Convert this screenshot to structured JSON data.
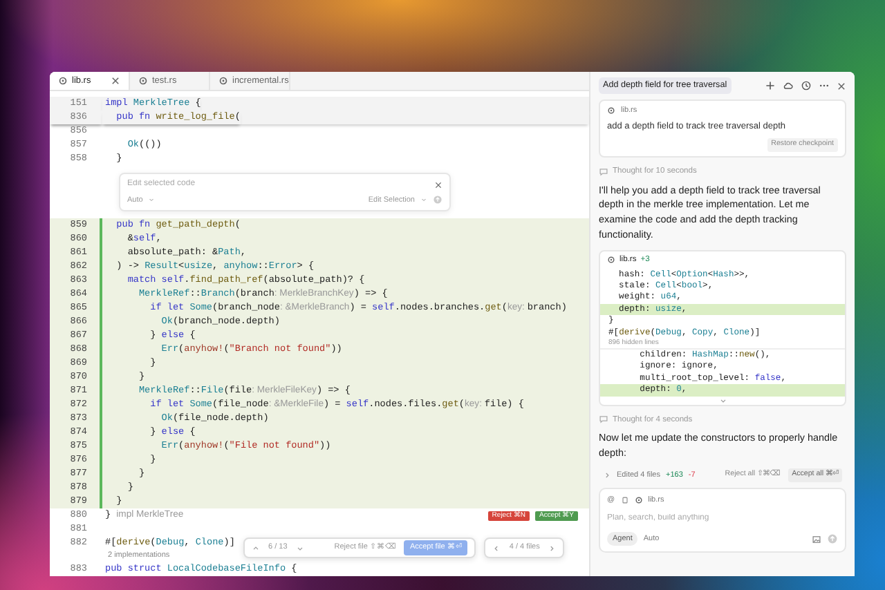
{
  "tabs": [
    {
      "label": "lib.rs",
      "selected": true
    },
    {
      "label": "test.rs",
      "selected": false
    },
    {
      "label": "incremental.rs",
      "selected": false
    }
  ],
  "editor": {
    "lines": [
      {
        "kind": "code",
        "number": "151",
        "sticky": true,
        "added": false,
        "tokens": [
          {
            "kind": "kw",
            "text": "impl "
          },
          {
            "kind": "type",
            "text": "MerkleTree"
          },
          {
            "kind": "plain",
            "text": " {"
          }
        ]
      },
      {
        "kind": "code",
        "number": "836",
        "sticky": true,
        "added": false,
        "tokens": [
          {
            "kind": "kw",
            "text": "  pub fn "
          },
          {
            "kind": "fn",
            "text": "write_log_file"
          },
          {
            "kind": "plain",
            "text": "("
          }
        ]
      },
      {
        "kind": "code",
        "number": "856",
        "sticky": false,
        "added": false
      },
      {
        "kind": "code",
        "number": "857",
        "sticky": false,
        "added": false,
        "tokens": [
          {
            "kind": "type",
            "text": "    Ok"
          },
          {
            "kind": "plain",
            "text": "(())"
          }
        ]
      },
      {
        "kind": "code",
        "number": "858",
        "sticky": false,
        "added": false,
        "tokens": [
          {
            "kind": "plain",
            "text": "  }"
          }
        ]
      },
      {
        "kind": "inline_edit",
        "placeholder": "Edit selected code",
        "model": "Auto",
        "action": "Edit Selection"
      },
      {
        "kind": "code",
        "number": "859",
        "sticky": false,
        "added": true,
        "tokens": [
          {
            "kind": "kw",
            "text": "  pub fn "
          },
          {
            "kind": "fn",
            "text": "get_path_depth"
          },
          {
            "kind": "plain",
            "text": "("
          }
        ]
      },
      {
        "kind": "code",
        "number": "860",
        "sticky": false,
        "added": true,
        "tokens": [
          {
            "kind": "plain",
            "text": "    &"
          },
          {
            "kind": "kw",
            "text": "self"
          },
          {
            "kind": "plain",
            "text": ","
          }
        ]
      },
      {
        "kind": "code",
        "number": "861",
        "sticky": false,
        "added": true,
        "tokens": [
          {
            "kind": "plain",
            "text": "    absolute_path: &"
          },
          {
            "kind": "type",
            "text": "Path"
          },
          {
            "kind": "plain",
            "text": ","
          }
        ]
      },
      {
        "kind": "code",
        "number": "862",
        "sticky": false,
        "added": true,
        "tokens": [
          {
            "kind": "plain",
            "text": "  ) -> "
          },
          {
            "kind": "type",
            "text": "Result"
          },
          {
            "kind": "plain",
            "text": "<"
          },
          {
            "kind": "type",
            "text": "usize"
          },
          {
            "kind": "plain",
            "text": ", "
          },
          {
            "kind": "type",
            "text": "anyhow"
          },
          {
            "kind": "plain",
            "text": "::"
          },
          {
            "kind": "type",
            "text": "Error"
          },
          {
            "kind": "plain",
            "text": "> {"
          }
        ]
      },
      {
        "kind": "code",
        "number": "863",
        "sticky": false,
        "added": true,
        "tokens": [
          {
            "kind": "kw",
            "text": "    match self"
          },
          {
            "kind": "plain",
            "text": "."
          },
          {
            "kind": "fn",
            "text": "find_path_ref"
          },
          {
            "kind": "plain",
            "text": "(absolute_path)? {"
          }
        ]
      },
      {
        "kind": "code",
        "number": "864",
        "sticky": false,
        "added": true,
        "tokens": [
          {
            "kind": "type",
            "text": "      MerkleRef"
          },
          {
            "kind": "plain",
            "text": "::"
          },
          {
            "kind": "type",
            "text": "Branch"
          },
          {
            "kind": "plain",
            "text": "(branch"
          },
          {
            "kind": "hint",
            "text": ": MerkleBranchKey"
          },
          {
            "kind": "plain",
            "text": ") => {"
          }
        ]
      },
      {
        "kind": "code",
        "number": "865",
        "sticky": false,
        "added": true,
        "tokens": [
          {
            "kind": "kw",
            "text": "        if let "
          },
          {
            "kind": "type",
            "text": "Some"
          },
          {
            "kind": "plain",
            "text": "(branch_node"
          },
          {
            "kind": "hint",
            "text": ": &MerkleBranch"
          },
          {
            "kind": "plain",
            "text": ") = "
          },
          {
            "kind": "kw",
            "text": "self"
          },
          {
            "kind": "plain",
            "text": ".nodes.branches."
          },
          {
            "kind": "fn",
            "text": "get"
          },
          {
            "kind": "plain",
            "text": "("
          },
          {
            "kind": "hint",
            "text": "key: "
          },
          {
            "kind": "plain",
            "text": "branch)"
          }
        ]
      },
      {
        "kind": "code",
        "number": "866",
        "sticky": false,
        "added": true,
        "tokens": [
          {
            "kind": "type",
            "text": "          Ok"
          },
          {
            "kind": "plain",
            "text": "(branch_node.depth)"
          }
        ]
      },
      {
        "kind": "code",
        "number": "867",
        "sticky": false,
        "added": true,
        "tokens": [
          {
            "kind": "plain",
            "text": "        } "
          },
          {
            "kind": "kw",
            "text": "else"
          },
          {
            "kind": "plain",
            "text": " {"
          }
        ]
      },
      {
        "kind": "code",
        "number": "868",
        "sticky": false,
        "added": true,
        "tokens": [
          {
            "kind": "type",
            "text": "          Err"
          },
          {
            "kind": "plain",
            "text": "("
          },
          {
            "kind": "macro",
            "text": "anyhow!"
          },
          {
            "kind": "plain",
            "text": "("
          },
          {
            "kind": "str",
            "text": "\"Branch not found\""
          },
          {
            "kind": "plain",
            "text": "))"
          }
        ]
      },
      {
        "kind": "code",
        "number": "869",
        "sticky": false,
        "added": true,
        "tokens": [
          {
            "kind": "plain",
            "text": "        }"
          }
        ]
      },
      {
        "kind": "code",
        "number": "870",
        "sticky": false,
        "added": true,
        "tokens": [
          {
            "kind": "plain",
            "text": "      }"
          }
        ]
      },
      {
        "kind": "code",
        "number": "871",
        "sticky": false,
        "added": true,
        "tokens": [
          {
            "kind": "type",
            "text": "      MerkleRef"
          },
          {
            "kind": "plain",
            "text": "::"
          },
          {
            "kind": "type",
            "text": "File"
          },
          {
            "kind": "plain",
            "text": "(file"
          },
          {
            "kind": "hint",
            "text": ": MerkleFileKey"
          },
          {
            "kind": "plain",
            "text": ") => {"
          }
        ]
      },
      {
        "kind": "code",
        "number": "872",
        "sticky": false,
        "added": true,
        "tokens": [
          {
            "kind": "kw",
            "text": "        if let "
          },
          {
            "kind": "type",
            "text": "Some"
          },
          {
            "kind": "plain",
            "text": "(file_node"
          },
          {
            "kind": "hint",
            "text": ": &MerkleFile"
          },
          {
            "kind": "plain",
            "text": ") = "
          },
          {
            "kind": "kw",
            "text": "self"
          },
          {
            "kind": "plain",
            "text": ".nodes.files."
          },
          {
            "kind": "fn",
            "text": "get"
          },
          {
            "kind": "plain",
            "text": "("
          },
          {
            "kind": "hint",
            "text": "key: "
          },
          {
            "kind": "plain",
            "text": "file) {"
          }
        ]
      },
      {
        "kind": "code",
        "number": "873",
        "sticky": false,
        "added": true,
        "tokens": [
          {
            "kind": "type",
            "text": "          Ok"
          },
          {
            "kind": "plain",
            "text": "(file_node.depth)"
          }
        ]
      },
      {
        "kind": "code",
        "number": "874",
        "sticky": false,
        "added": true,
        "tokens": [
          {
            "kind": "plain",
            "text": "        } "
          },
          {
            "kind": "kw",
            "text": "else"
          },
          {
            "kind": "plain",
            "text": " {"
          }
        ]
      },
      {
        "kind": "code",
        "number": "875",
        "sticky": false,
        "added": true,
        "tokens": [
          {
            "kind": "type",
            "text": "          Err"
          },
          {
            "kind": "plain",
            "text": "("
          },
          {
            "kind": "macro",
            "text": "anyhow!"
          },
          {
            "kind": "plain",
            "text": "("
          },
          {
            "kind": "str",
            "text": "\"File not found\""
          },
          {
            "kind": "plain",
            "text": "))"
          }
        ]
      },
      {
        "kind": "code",
        "number": "876",
        "sticky": false,
        "added": true,
        "tokens": [
          {
            "kind": "plain",
            "text": "        }"
          }
        ]
      },
      {
        "kind": "code",
        "number": "877",
        "sticky": false,
        "added": true,
        "tokens": [
          {
            "kind": "plain",
            "text": "      }"
          }
        ]
      },
      {
        "kind": "code",
        "number": "878",
        "sticky": false,
        "added": true,
        "tokens": [
          {
            "kind": "plain",
            "text": "    }"
          }
        ]
      },
      {
        "kind": "code",
        "number": "879",
        "sticky": false,
        "added": true,
        "tokens": [
          {
            "kind": "plain",
            "text": "  }"
          }
        ]
      },
      {
        "kind": "code",
        "number": "880",
        "sticky": false,
        "added": false,
        "tokens": [
          {
            "kind": "plain",
            "text": "} "
          },
          {
            "kind": "hint",
            "text": "impl MerkleTree"
          }
        ],
        "actions": {
          "reject": "Reject ⌘N",
          "accept": "Accept ⌘Y"
        }
      },
      {
        "kind": "code",
        "number": "881",
        "sticky": false,
        "added": false
      },
      {
        "kind": "code",
        "number": "882",
        "sticky": false,
        "added": false,
        "tokens": [
          {
            "kind": "plain",
            "text": "#["
          },
          {
            "kind": "fn",
            "text": "derive"
          },
          {
            "kind": "plain",
            "text": "("
          },
          {
            "kind": "type",
            "text": "Debug"
          },
          {
            "kind": "plain",
            "text": ", "
          },
          {
            "kind": "type",
            "text": "Clone"
          },
          {
            "kind": "plain",
            "text": ")]"
          }
        ]
      },
      {
        "kind": "lens",
        "text": "2 implementations"
      },
      {
        "kind": "code",
        "number": "883",
        "sticky": false,
        "added": false,
        "tokens": [
          {
            "kind": "kw",
            "text": "pub struct "
          },
          {
            "kind": "type",
            "text": "LocalCodebaseFileInfo"
          },
          {
            "kind": "plain",
            "text": " {"
          }
        ]
      }
    ],
    "review_bar": {
      "hunk_counter": "6 / 13",
      "reject_file": "Reject file ⇧⌘⌫",
      "accept_file": "Accept file ⌘⏎",
      "file_counter": "4 / 4 files"
    }
  },
  "chat": {
    "title": "Add depth field for tree traversal",
    "user_message": {
      "file": "lib.rs",
      "text": "add a depth field to track tree traversal depth",
      "restore": "Restore checkpoint"
    },
    "messages": [
      {
        "kind": "thought",
        "text": "Thought for 10 seconds"
      },
      {
        "kind": "text",
        "text": "I'll help you add a depth field to track tree traversal depth in the merkle tree implementation. Let me examine the code and add the depth tracking functionality."
      },
      {
        "kind": "diff",
        "file": "lib.rs",
        "stat": "+3",
        "lines": [
          {
            "kind": "code",
            "added": false,
            "tokens": [
              {
                "kind": "plain",
                "text": "  hash: "
              },
              {
                "kind": "type",
                "text": "Cell"
              },
              {
                "kind": "plain",
                "text": "<"
              },
              {
                "kind": "type",
                "text": "Option"
              },
              {
                "kind": "plain",
                "text": "<"
              },
              {
                "kind": "type",
                "text": "Hash"
              },
              {
                "kind": "plain",
                "text": ">>,"
              }
            ]
          },
          {
            "kind": "code",
            "added": false,
            "tokens": [
              {
                "kind": "plain",
                "text": "  stale: "
              },
              {
                "kind": "type",
                "text": "Cell"
              },
              {
                "kind": "plain",
                "text": "<"
              },
              {
                "kind": "type",
                "text": "bool"
              },
              {
                "kind": "plain",
                "text": ">,"
              }
            ]
          },
          {
            "kind": "code",
            "added": false,
            "tokens": [
              {
                "kind": "plain",
                "text": "  weight: "
              },
              {
                "kind": "type",
                "text": "u64"
              },
              {
                "kind": "plain",
                "text": ","
              }
            ]
          },
          {
            "kind": "code",
            "added": true,
            "tokens": [
              {
                "kind": "plain",
                "text": "  depth: "
              },
              {
                "kind": "type",
                "text": "usize"
              },
              {
                "kind": "plain",
                "text": ","
              }
            ]
          },
          {
            "kind": "code",
            "added": false,
            "tokens": [
              {
                "kind": "plain",
                "text": "}"
              }
            ]
          },
          {
            "kind": "code",
            "added": false,
            "tokens": [
              {
                "kind": "plain",
                "text": "#["
              },
              {
                "kind": "fn",
                "text": "derive"
              },
              {
                "kind": "plain",
                "text": "("
              },
              {
                "kind": "type",
                "text": "Debug"
              },
              {
                "kind": "plain",
                "text": ", "
              },
              {
                "kind": "type",
                "text": "Copy"
              },
              {
                "kind": "plain",
                "text": ", "
              },
              {
                "kind": "type",
                "text": "Clone"
              },
              {
                "kind": "plain",
                "text": ")]"
              }
            ]
          },
          {
            "kind": "hidden",
            "text": "896 hidden lines"
          },
          {
            "kind": "code",
            "added": false,
            "tokens": [
              {
                "kind": "plain",
                "text": "      children: "
              },
              {
                "kind": "type",
                "text": "HashMap"
              },
              {
                "kind": "plain",
                "text": "::"
              },
              {
                "kind": "fn",
                "text": "new"
              },
              {
                "kind": "plain",
                "text": "(),"
              }
            ]
          },
          {
            "kind": "code",
            "added": false,
            "tokens": [
              {
                "kind": "plain",
                "text": "      ignore: ignore,"
              }
            ]
          },
          {
            "kind": "code",
            "added": false,
            "tokens": [
              {
                "kind": "plain",
                "text": "      multi_root_top_level: "
              },
              {
                "kind": "kw",
                "text": "false"
              },
              {
                "kind": "plain",
                "text": ","
              }
            ]
          },
          {
            "kind": "code",
            "added": true,
            "tokens": [
              {
                "kind": "plain",
                "text": "      depth: "
              },
              {
                "kind": "type",
                "text": "0"
              },
              {
                "kind": "plain",
                "text": ","
              }
            ]
          }
        ]
      },
      {
        "kind": "thought",
        "text": "Thought for 4 seconds"
      },
      {
        "kind": "text",
        "text": "Now let me update the constructors to properly handle depth:"
      }
    ],
    "edited": {
      "summary": "Edited 4 files",
      "added": "+163",
      "removed": "-7",
      "reject": "Reject all ⇧⌘⌫",
      "accept": "Accept all ⌘⏎"
    },
    "composer": {
      "mention": "@",
      "context_file": "lib.rs",
      "placeholder": "Plan, search, build anything",
      "mode": "Agent",
      "model": "Auto"
    }
  }
}
